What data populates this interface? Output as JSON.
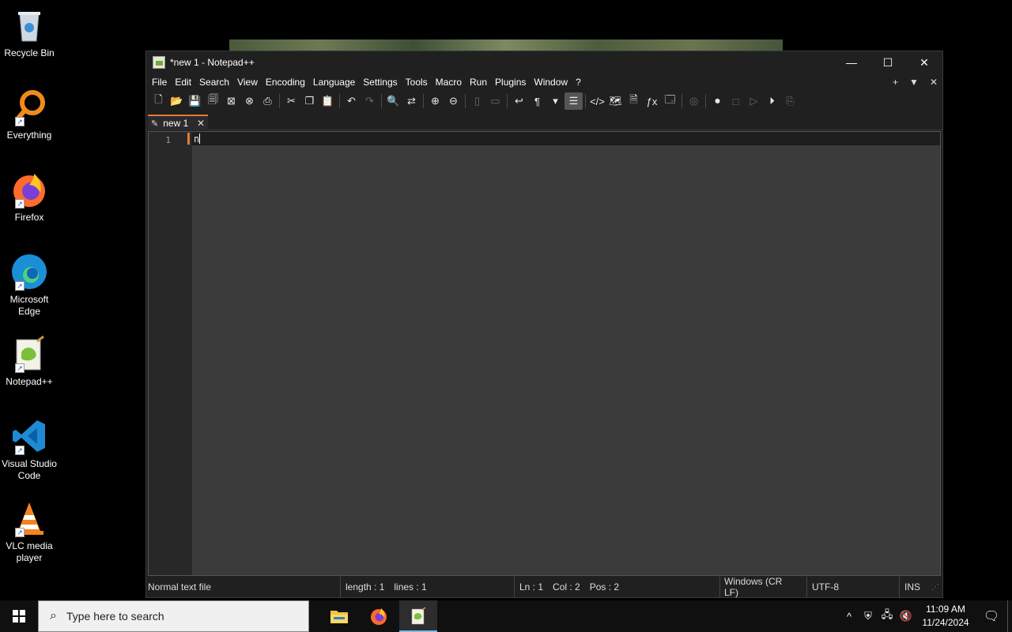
{
  "desktop": {
    "icons": [
      {
        "label": "Recycle Bin",
        "icon": "recycle-bin-icon"
      },
      {
        "label": "Everything",
        "icon": "everything-search-icon"
      },
      {
        "label": "Firefox",
        "icon": "firefox-icon"
      },
      {
        "label": "Microsoft Edge",
        "icon": "edge-icon"
      },
      {
        "label": "Notepad++",
        "icon": "notepadpp-icon"
      },
      {
        "label": "Visual Studio Code",
        "icon": "vscode-icon"
      },
      {
        "label": "VLC media player",
        "icon": "vlc-icon"
      }
    ]
  },
  "window": {
    "title": "*new 1 - Notepad++",
    "menu": [
      "File",
      "Edit",
      "Search",
      "View",
      "Encoding",
      "Language",
      "Settings",
      "Tools",
      "Macro",
      "Run",
      "Plugins",
      "Window",
      "?"
    ],
    "menu_right": [
      "+",
      "▼",
      "✕"
    ],
    "tab": {
      "label": "new 1"
    },
    "editor": {
      "line_number": "1",
      "content": "n"
    },
    "status": {
      "file_type": "Normal text file",
      "length": "length : 1",
      "lines": "lines : 1",
      "ln": "Ln : 1",
      "col": "Col : 2",
      "pos": "Pos : 2",
      "eol": "Windows (CR LF)",
      "encoding": "UTF-8",
      "mode": "INS"
    }
  },
  "taskbar": {
    "search_placeholder": "Type here to search",
    "time": "11:09 AM",
    "date": "11/24/2024"
  },
  "colors": {
    "accent": "#e07b3c",
    "editor_bg": "#3b3b3b",
    "taskbar_accent": "#76b9ed"
  }
}
